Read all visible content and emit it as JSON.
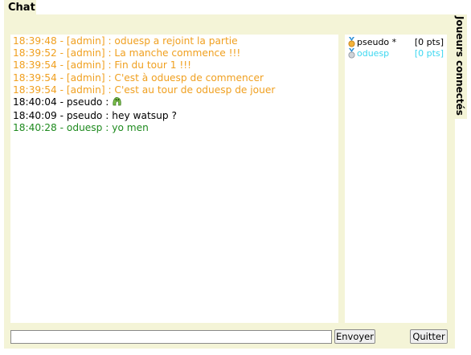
{
  "chat_tab": {
    "label": "Chat"
  },
  "side_tab": {
    "label": "Joueurs connectés"
  },
  "messages": [
    {
      "type": "admin",
      "text": "18:39:48 - [admin] : oduesp a rejoint la partie"
    },
    {
      "type": "admin",
      "text": "18:39:52 - [admin] : La manche commence !!!"
    },
    {
      "type": "admin",
      "text": "18:39:54 - [admin] : Fin du tour 1 !!!"
    },
    {
      "type": "admin",
      "text": "18:39:54 - [admin] : C'est à oduesp de commencer"
    },
    {
      "type": "admin",
      "text": "18:39:54 - [admin] : C'est au tour de oduesp de jouer"
    },
    {
      "type": "user",
      "text": "18:40:04 - pseudo : ",
      "icon": "smiley-icon"
    },
    {
      "type": "user",
      "text": "18:40:09 - pseudo : hey watsup ?"
    },
    {
      "type": "self",
      "text": "18:40:28 - oduesp : yo men"
    }
  ],
  "players": [
    {
      "name": "pseudo *",
      "points": "[0 pts]",
      "color": "#000000",
      "icon": "gold-medal-icon"
    },
    {
      "name": "oduesp",
      "points": "[0 pts]",
      "color": "#3cd7f0",
      "icon": "silver-medal-icon"
    }
  ],
  "input": {
    "value": "",
    "placeholder": ""
  },
  "buttons": {
    "send": "Envoyer",
    "quit": "Quitter"
  },
  "colors": {
    "panel_bg": "#f4f4d7",
    "admin_text": "#f0a020",
    "self_text": "#1e8a1e",
    "player2_text": "#3cd7f0"
  }
}
